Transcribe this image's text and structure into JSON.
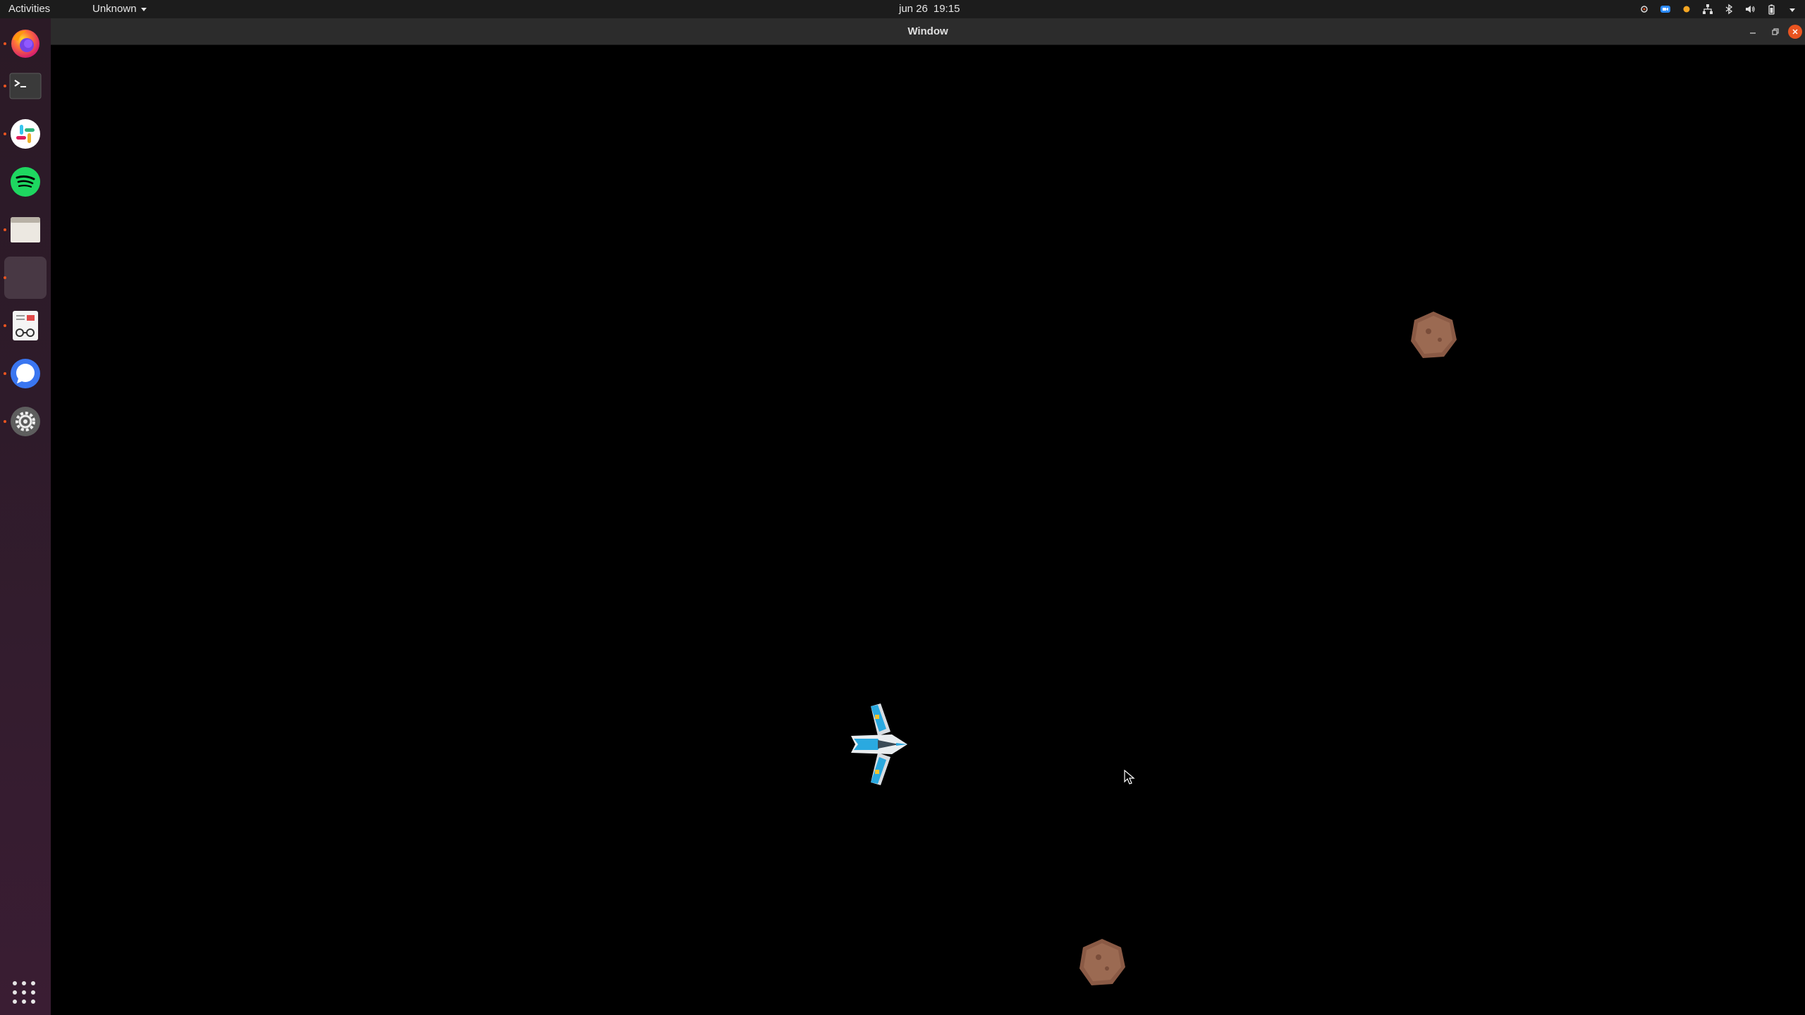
{
  "topbar": {
    "activities": "Activities",
    "app_menu": "Unknown",
    "date": "jun 26",
    "time": "19:15"
  },
  "dock": {
    "items": [
      {
        "name": "firefox-icon",
        "running": true
      },
      {
        "name": "terminal-icon",
        "running": true
      },
      {
        "name": "slack-icon",
        "running": true
      },
      {
        "name": "spotify-icon",
        "running": true
      },
      {
        "name": "files-icon",
        "running": true
      },
      {
        "name": "active-app",
        "running": true
      },
      {
        "name": "document-viewer-icon",
        "running": true
      },
      {
        "name": "signal-icon",
        "running": true
      },
      {
        "name": "settings-icon",
        "running": true
      }
    ],
    "show_apps_icon": "grid-icon"
  },
  "window": {
    "title": "Window"
  },
  "game": {
    "background": "#000000",
    "player": "spaceship",
    "asteroid_color": "#8a5a45",
    "asteroid_count": 2
  },
  "colors": {
    "accent": "#e95420",
    "topbar": "#1c1c1c",
    "titlebar": "#2c2c2c"
  }
}
